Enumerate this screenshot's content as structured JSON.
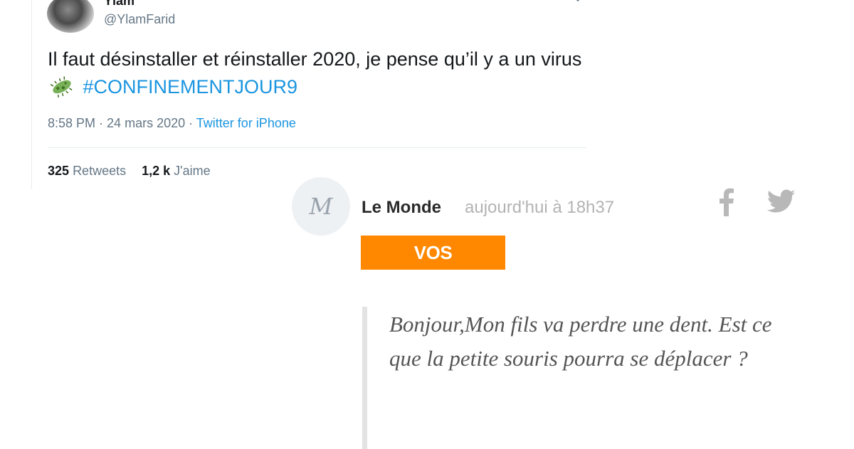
{
  "tweet": {
    "display_name": "Ylam",
    "handle": "@YlamFarid",
    "text_part1": "Il faut désinstaller et réinstaller 2020, je pense qu’il y a un virus",
    "hashtag": "#CONFINEMENTJOUR9",
    "emoji_icon": "microbe-icon",
    "time": "8:58 PM",
    "date": "24 mars 2020",
    "separator": " · ",
    "source": "Twitter for iPhone",
    "retweets_count": "325",
    "retweets_label": "Retweets",
    "likes_count": "1,2 k",
    "likes_label": "J'aime",
    "colors": {
      "link": "#1b95e0",
      "text": "#14171a",
      "muted": "#657786"
    }
  },
  "lemonde": {
    "logo_letter": "M",
    "name": "Le Monde",
    "timestamp": "aujourd'hui à 18h37",
    "share_icons": [
      "facebook-icon",
      "twitter-icon"
    ],
    "badge": "VOS QUESTIONS",
    "badge_color": "#ff8800",
    "question": "Bonjour,Mon fils va perdre une dent. Est ce que la petite souris pourra se déplacer ?"
  }
}
